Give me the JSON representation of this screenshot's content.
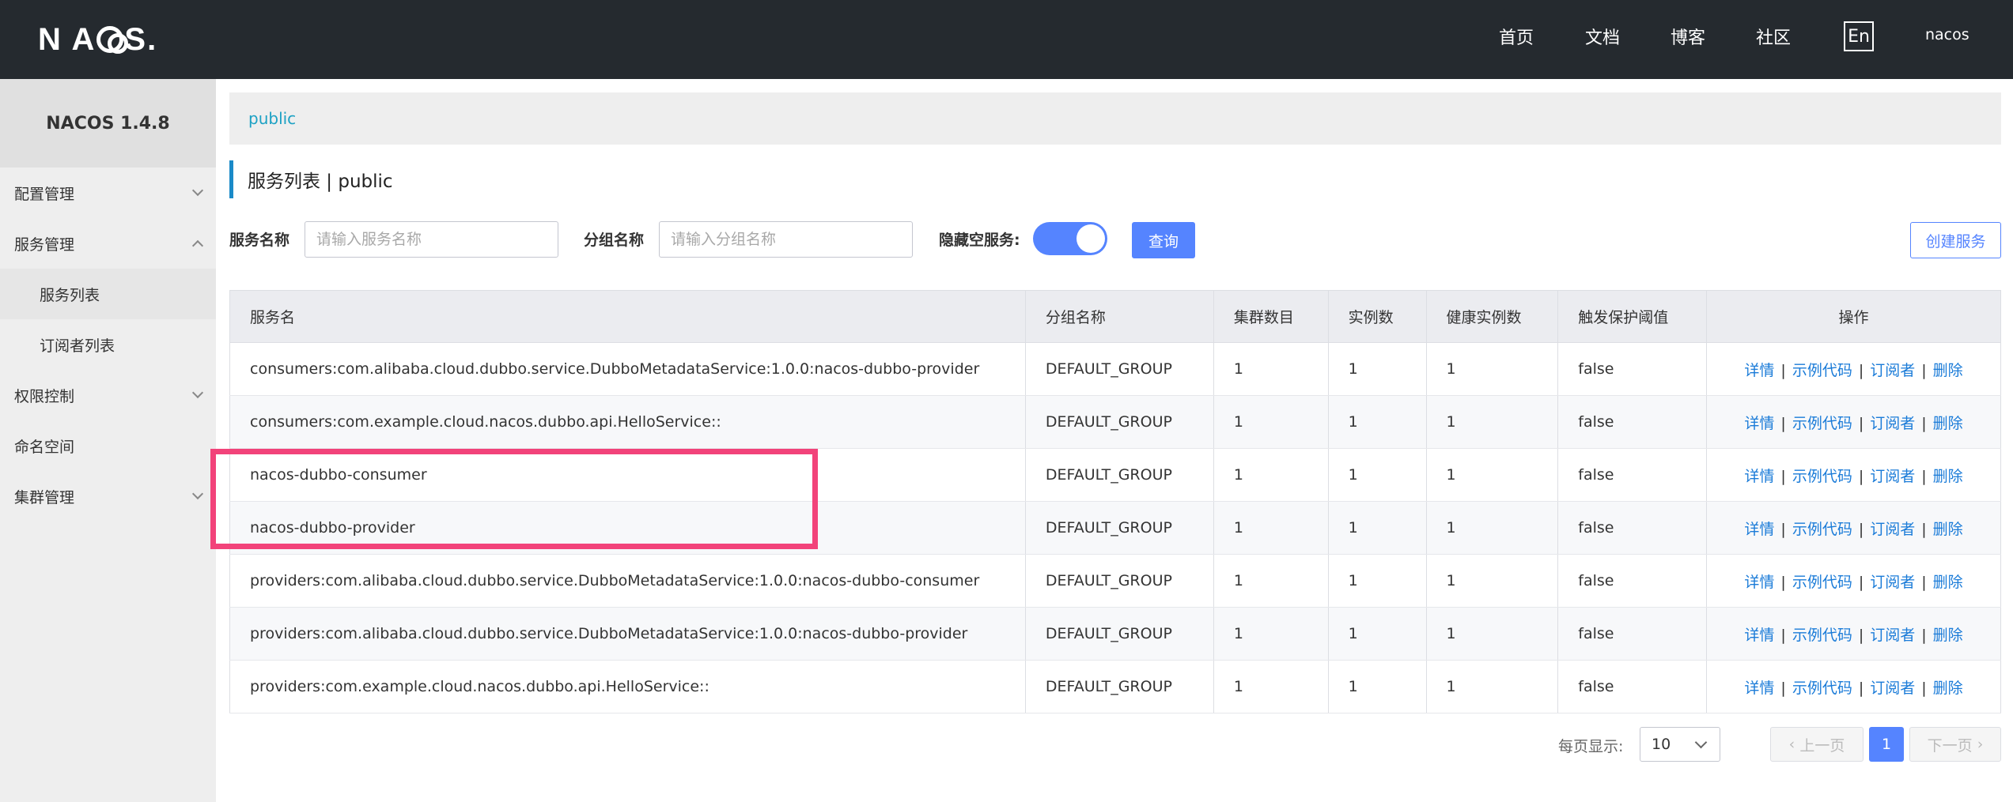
{
  "header": {
    "logo_text": "NACOS.",
    "nav": [
      "首页",
      "文档",
      "博客",
      "社区"
    ],
    "lang": "En",
    "user": "nacos"
  },
  "sidebar": {
    "version": "NACOS 1.4.8",
    "items": [
      {
        "label": "配置管理",
        "expanded": false,
        "has_children": true
      },
      {
        "label": "服务管理",
        "expanded": true,
        "has_children": true
      },
      {
        "label": "服务列表",
        "sub": true,
        "active": true
      },
      {
        "label": "订阅者列表",
        "sub": true,
        "active": false
      },
      {
        "label": "权限控制",
        "expanded": false,
        "has_children": true
      },
      {
        "label": "命名空间",
        "has_children": false
      },
      {
        "label": "集群管理",
        "expanded": false,
        "has_children": true
      }
    ]
  },
  "breadcrumb": "public",
  "page_title": "服务列表  |  public",
  "filters": {
    "service_name_label": "服务名称",
    "service_name_placeholder": "请输入服务名称",
    "group_name_label": "分组名称",
    "group_name_placeholder": "请输入分组名称",
    "hide_empty_label": "隐藏空服务:",
    "hide_empty_on": true,
    "query_label": "查询",
    "create_label": "创建服务"
  },
  "table": {
    "headers": [
      "服务名",
      "分组名称",
      "集群数目",
      "实例数",
      "健康实例数",
      "触发保护阈值",
      "操作"
    ],
    "ops": [
      "详情",
      "示例代码",
      "订阅者",
      "删除"
    ],
    "rows": [
      [
        "consumers:com.alibaba.cloud.dubbo.service.DubboMetadataService:1.0.0:nacos-dubbo-provider",
        "DEFAULT_GROUP",
        "1",
        "1",
        "1",
        "false"
      ],
      [
        "consumers:com.example.cloud.nacos.dubbo.api.HelloService::",
        "DEFAULT_GROUP",
        "1",
        "1",
        "1",
        "false"
      ],
      [
        "nacos-dubbo-consumer",
        "DEFAULT_GROUP",
        "1",
        "1",
        "1",
        "false"
      ],
      [
        "nacos-dubbo-provider",
        "DEFAULT_GROUP",
        "1",
        "1",
        "1",
        "false"
      ],
      [
        "providers:com.alibaba.cloud.dubbo.service.DubboMetadataService:1.0.0:nacos-dubbo-consumer",
        "DEFAULT_GROUP",
        "1",
        "1",
        "1",
        "false"
      ],
      [
        "providers:com.alibaba.cloud.dubbo.service.DubboMetadataService:1.0.0:nacos-dubbo-provider",
        "DEFAULT_GROUP",
        "1",
        "1",
        "1",
        "false"
      ],
      [
        "providers:com.example.cloud.nacos.dubbo.api.HelloService::",
        "DEFAULT_GROUP",
        "1",
        "1",
        "1",
        "false"
      ]
    ]
  },
  "pagination": {
    "per_page_label": "每页显示:",
    "per_page": "10",
    "prev": "上一页",
    "current": "1",
    "next": "下一页"
  },
  "colors": {
    "accent": "#5584ff",
    "highlight": "#f2437a",
    "topbar": "#252a2f"
  }
}
